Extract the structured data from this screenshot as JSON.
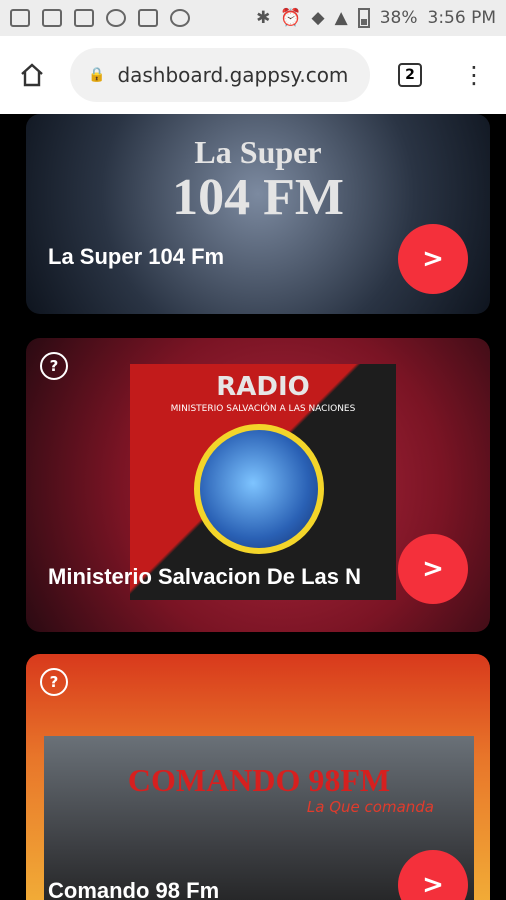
{
  "status_bar": {
    "battery_text": "38%",
    "time": "3:56 PM",
    "left_icons": [
      "message-icon",
      "facebook-icon",
      "image-icon",
      "instagram-icon",
      "mail-icon",
      "instagram-icon"
    ],
    "right_icons": [
      "bluetooth-icon",
      "alarm-icon",
      "wifi-icon",
      "signal-icon",
      "battery-icon"
    ]
  },
  "browser": {
    "url": "dashboard.gappsy.com",
    "tab_count": "2"
  },
  "stations": [
    {
      "name": "La Super 104 Fm",
      "logo_line1": "La Super",
      "logo_line2": "104 FM",
      "go_label": ">"
    },
    {
      "name": "Ministerio Salvacion De Las N",
      "badge": "?",
      "logo_title": "RADIO",
      "logo_subtitle": "MINISTERIO SALVACIÓN A LAS NACIONES",
      "go_label": ">"
    },
    {
      "name": "Comando 98 Fm",
      "badge": "?",
      "logo_title": "COMANDO 98FM",
      "logo_subtitle": "La Que comanda",
      "go_label": ">"
    }
  ],
  "colors": {
    "accent": "#f4303b",
    "background": "#000000"
  }
}
